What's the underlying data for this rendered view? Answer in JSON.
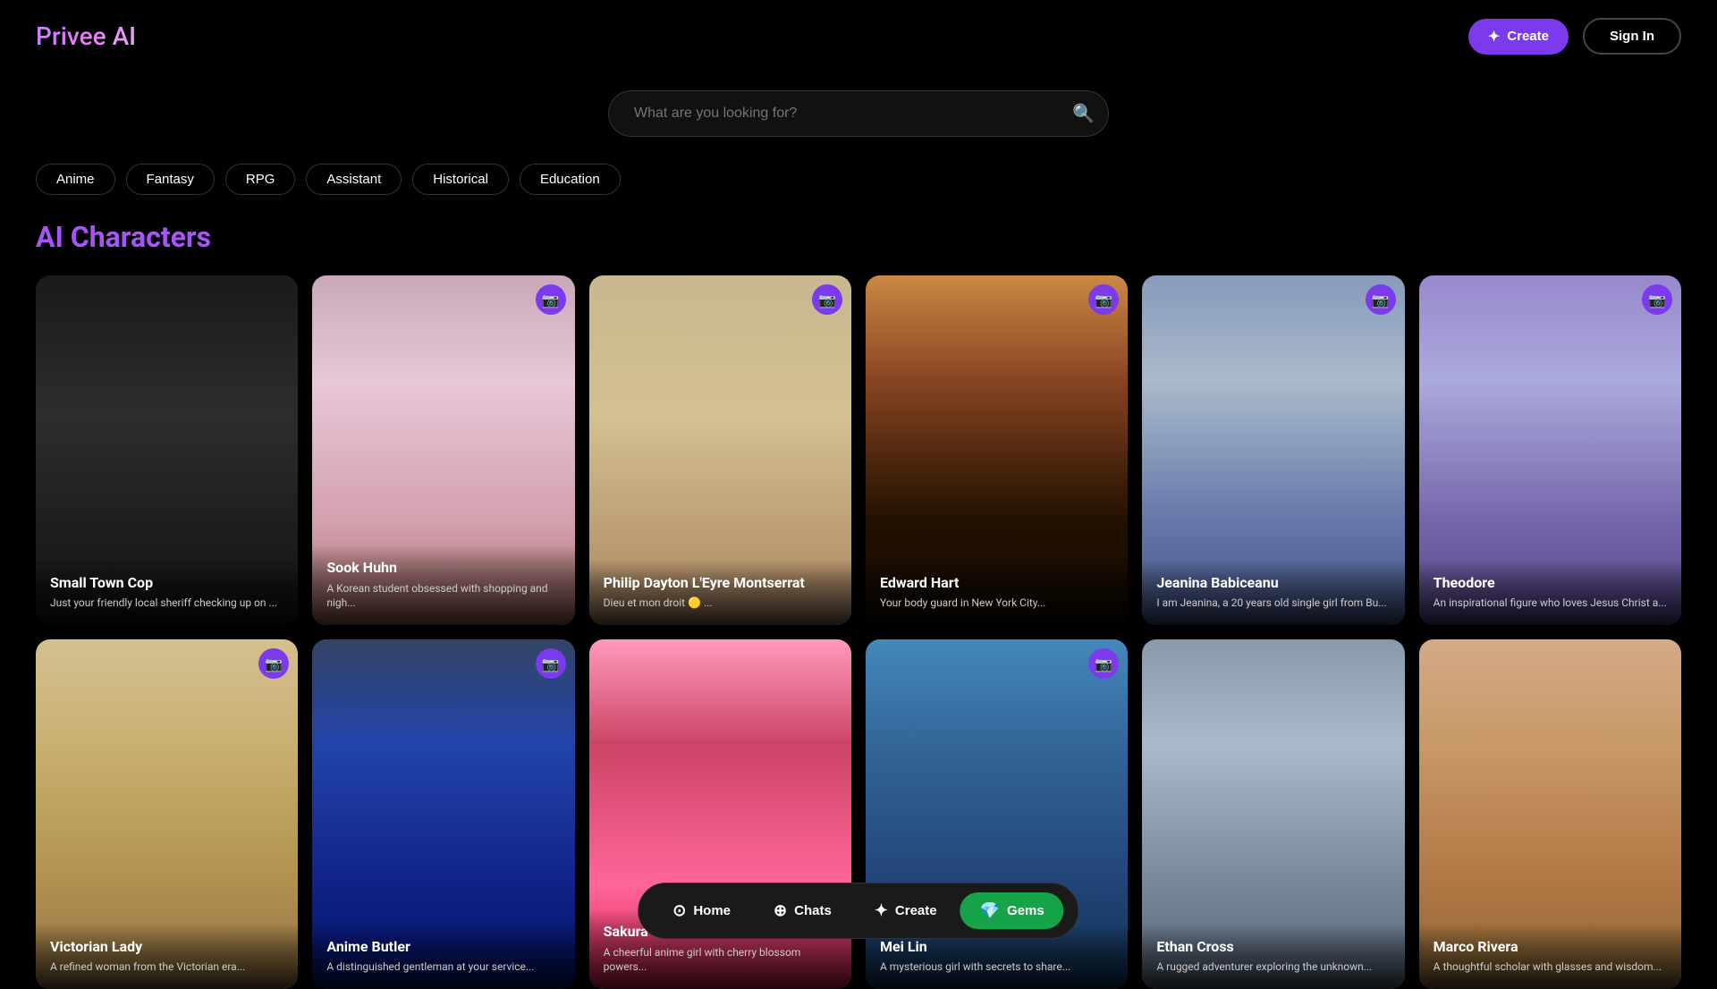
{
  "app": {
    "name": "Privee AI"
  },
  "header": {
    "create_label": "Create",
    "signin_label": "Sign In"
  },
  "search": {
    "placeholder": "What are you looking for?"
  },
  "filters": [
    {
      "id": "anime",
      "label": "Anime"
    },
    {
      "id": "fantasy",
      "label": "Fantasy"
    },
    {
      "id": "rpg",
      "label": "RPG"
    },
    {
      "id": "assistant",
      "label": "Assistant"
    },
    {
      "id": "historical",
      "label": "Historical"
    },
    {
      "id": "education",
      "label": "Education"
    }
  ],
  "section": {
    "title": "AI Characters"
  },
  "characters": [
    {
      "id": 1,
      "name": "Small Town Cop",
      "description": "Just your friendly local sheriff checking up on ...",
      "has_camera": false,
      "card_class": "card-1"
    },
    {
      "id": 2,
      "name": "Sook Huhn",
      "description": "A Korean student obsessed with shopping and nigh...",
      "has_camera": true,
      "card_class": "card-2"
    },
    {
      "id": 3,
      "name": "Philip Dayton L'Eyre Montserrat",
      "description": "Dieu et mon droit 🟡 ...",
      "has_camera": true,
      "card_class": "card-3"
    },
    {
      "id": 4,
      "name": "Edward Hart",
      "description": "Your body guard in New York City...",
      "has_camera": true,
      "card_class": "card-4"
    },
    {
      "id": 5,
      "name": "Jeanina Babiceanu",
      "description": "I am Jeanina, a 20 years old single girl from Bu...",
      "has_camera": true,
      "card_class": "card-5"
    },
    {
      "id": 6,
      "name": "Theodore",
      "description": "An inspirational figure who loves Jesus Christ a...",
      "has_camera": true,
      "card_class": "card-6"
    },
    {
      "id": 7,
      "name": "Victorian Lady",
      "description": "A refined woman from the Victorian era...",
      "has_camera": true,
      "card_class": "card-7"
    },
    {
      "id": 8,
      "name": "Anime Butler",
      "description": "A distinguished gentleman at your service...",
      "has_camera": true,
      "card_class": "card-8"
    },
    {
      "id": 9,
      "name": "Sakura",
      "description": "A cheerful anime girl with cherry blossom powers...",
      "has_camera": false,
      "card_class": "card-9"
    },
    {
      "id": 10,
      "name": "Mei Lin",
      "description": "A mysterious girl with secrets to share...",
      "has_camera": true,
      "card_class": "card-10"
    },
    {
      "id": 11,
      "name": "Ethan Cross",
      "description": "A rugged adventurer exploring the unknown...",
      "has_camera": false,
      "card_class": "card-11"
    },
    {
      "id": 12,
      "name": "Marco Rivera",
      "description": "A thoughtful scholar with glasses and wisdom...",
      "has_camera": false,
      "card_class": "card-12"
    }
  ],
  "bottom_nav": [
    {
      "id": "home",
      "label": "Home",
      "icon": "⊙",
      "active": true
    },
    {
      "id": "chats",
      "label": "Chats",
      "icon": "⊕",
      "active": false
    },
    {
      "id": "create",
      "label": "Create",
      "icon": "✦",
      "active": false
    },
    {
      "id": "gems",
      "label": "Gems",
      "icon": "💎",
      "active": false,
      "special": true
    }
  ],
  "icons": {
    "search": "🔍",
    "camera": "📷",
    "sparkle": "✦"
  }
}
